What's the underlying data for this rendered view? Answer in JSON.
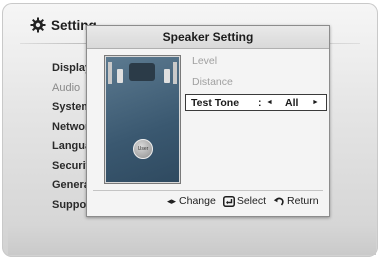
{
  "settings_menu": {
    "title": "Setting",
    "items": [
      {
        "label": "Display",
        "dim": false
      },
      {
        "label": "Audio",
        "dim": true
      },
      {
        "label": "System",
        "dim": false
      },
      {
        "label": "Network",
        "dim": false
      },
      {
        "label": "Language",
        "dim": false
      },
      {
        "label": "Security",
        "dim": false
      },
      {
        "label": "General",
        "dim": false
      },
      {
        "label": "Support",
        "dim": false
      }
    ]
  },
  "dialog": {
    "title": "Speaker Setting",
    "options": {
      "level": "Level",
      "distance": "Distance"
    },
    "test_tone": {
      "label": "Test Tone",
      "separator": ":",
      "left_arrow": "◄",
      "value": "All",
      "right_arrow": "►"
    },
    "speaker_diagram": {
      "user_label": "User"
    },
    "hints": {
      "change": "Change",
      "select": "Select",
      "return": "Return"
    }
  },
  "icons": {
    "settings": "gear-icon",
    "change": "left-right-arrows-icon",
    "select": "enter-key-icon",
    "return": "return-arrow-icon"
  }
}
